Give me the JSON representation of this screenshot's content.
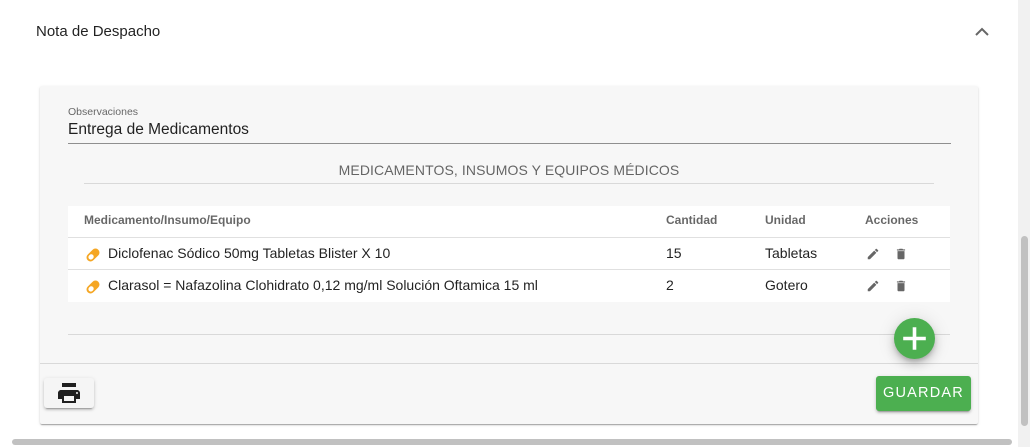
{
  "panel": {
    "title": "Nota de Despacho"
  },
  "observations": {
    "label": "Observaciones",
    "value": "Entrega de Medicamentos"
  },
  "section": {
    "title": "MEDICAMENTOS, INSUMOS Y EQUIPOS MÉDICOS"
  },
  "table": {
    "headers": {
      "item": "Medicamento/Insumo/Equipo",
      "quantity": "Cantidad",
      "unit": "Unidad",
      "actions": "Acciones"
    },
    "rows": [
      {
        "item": "Diclofenac Sódico 50mg Tabletas Blister X 10",
        "quantity": "15",
        "unit": "Tabletas",
        "icon": "pill-icon"
      },
      {
        "item": "Clarasol = Nafazolina Clohidrato 0,12 mg/ml Solución Oftamica 15 ml",
        "quantity": "2",
        "unit": "Gotero",
        "icon": "pill-icon"
      }
    ]
  },
  "buttons": {
    "save_label": "GUARDAR",
    "print_icon": "print-icon",
    "add_icon": "plus-icon"
  },
  "colors": {
    "accent": "#4caf50",
    "pill": "#f5a623"
  }
}
